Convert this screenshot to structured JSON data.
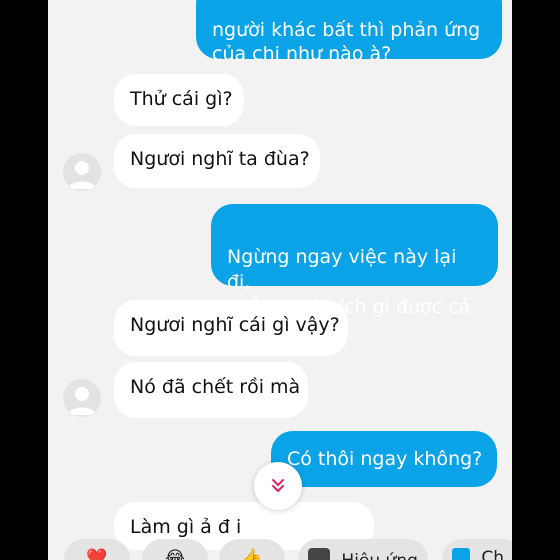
{
  "messages": {
    "m1": "người khác bất thì phản ứng\ncủa chị như nào à?",
    "m2": "Thử cái gì?",
    "m3": "Ngươi nghĩ ta đùa?",
    "m4": "Ngừng ngay việc này lại đi,\nchẳng giúp ích gì được cả",
    "m5": "Ngươi nghĩ cái gì vậy?",
    "m6": "Nó đã chết rồi mà",
    "m7": "Có thôi ngay không?",
    "m8": "Làm  gì  ả  đ i  "
  },
  "quick_reactions": {
    "heart": "❤️",
    "laugh": "😂",
    "thumbs": "👍",
    "effects_label": "Hiệu ứng",
    "last_label": "Ch"
  },
  "colors": {
    "outgoing": "#0aa3e8",
    "incoming": "#ffffff",
    "background": "#f2f2f2",
    "accent": "#e0245e"
  },
  "icons": {
    "scroll_down": "double-chevron-down-icon"
  }
}
